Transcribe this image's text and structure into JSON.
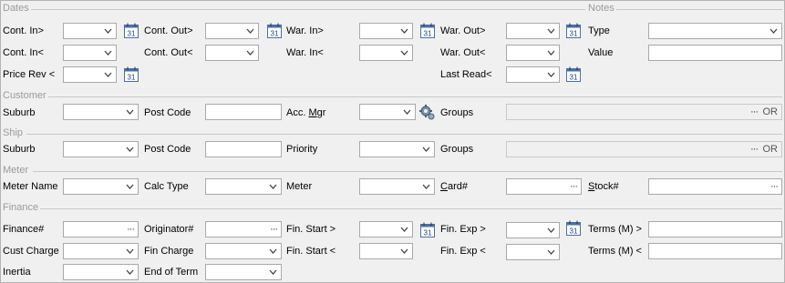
{
  "sections": {
    "dates": "Dates",
    "notes": "Notes",
    "customer": "Customer",
    "ship": "Ship",
    "meter": "Meter",
    "finance": "Finance"
  },
  "dates": {
    "cont_in_gt": "Cont. In>",
    "cont_out_gt": "Cont. Out>",
    "war_in_gt": "War. In>",
    "war_out_gt": "War. Out>",
    "cont_in_lt": "Cont. In<",
    "cont_out_lt": "Cont. Out<",
    "war_in_lt": "War. In<",
    "war_out_lt": "War. Out<",
    "price_rev_lt": "Price Rev <",
    "last_read_lt": "Last Read<",
    "calendar_day": "31"
  },
  "notes": {
    "type": "Type",
    "value": "Value"
  },
  "customer": {
    "suburb": "Suburb",
    "post_code": "Post Code",
    "acc_mgr_prefix": "Acc. ",
    "acc_mgr_underlined": "M",
    "acc_mgr_suffix": "gr",
    "groups": "Groups",
    "groups_ellipsis": "···",
    "groups_or": "OR"
  },
  "ship": {
    "suburb": "Suburb",
    "post_code": "Post Code",
    "priority": "Priority",
    "groups": "Groups",
    "groups_ellipsis": "···",
    "groups_or": "OR"
  },
  "meter": {
    "meter_name": "Meter Name",
    "calc_type": "Calc Type",
    "meter": "Meter",
    "card_underlined": "C",
    "card_suffix": "ard#",
    "stock_underlined": "S",
    "stock_suffix": "tock#",
    "ellipsis": "···"
  },
  "finance": {
    "finance_no": "Finance#",
    "originator_no": "Originator#",
    "fin_start_gt": "Fin. Start >",
    "fin_exp_gt": "Fin. Exp >",
    "terms_gt": "Terms (M) >",
    "cust_charge": "Cust Charge",
    "fin_charge": "Fin Charge",
    "fin_start_lt": "Fin. Start <",
    "fin_exp_lt": "Fin. Exp <",
    "terms_lt": "Terms (M) <",
    "inertia": "Inertia",
    "end_of_term": "End of Term",
    "ellipsis": "···"
  }
}
